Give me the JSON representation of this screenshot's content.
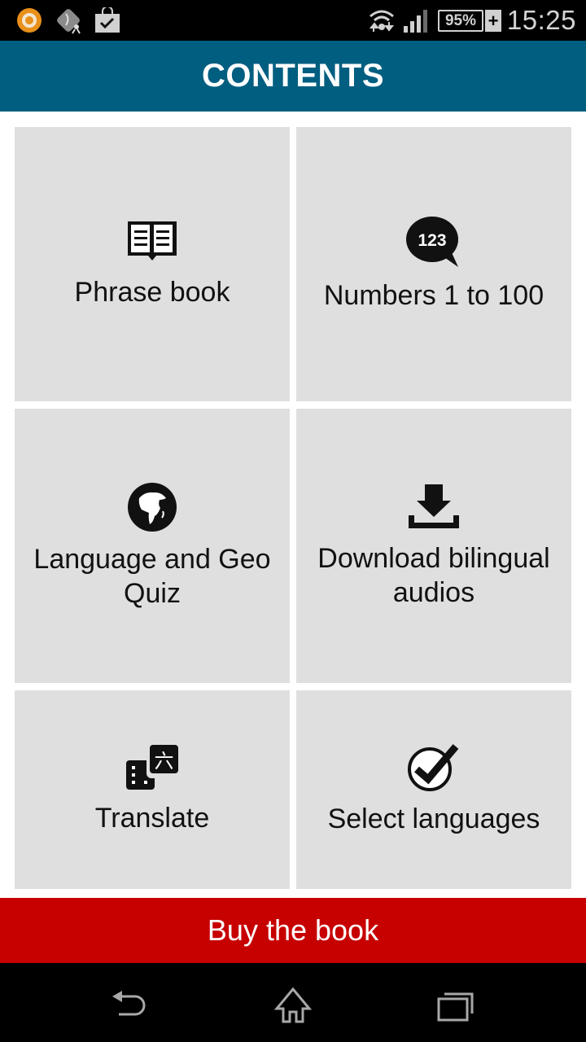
{
  "status_bar": {
    "notification_icons": [
      "avast-icon",
      "app-runner-icon",
      "shopping-bag-check-icon"
    ],
    "system_icons": [
      "wifi-icon",
      "signal-icon",
      "battery-icon",
      "charging-plus-icon"
    ],
    "battery_percent": "95%",
    "time": "15:25"
  },
  "header": {
    "title": "CONTENTS"
  },
  "tiles": [
    {
      "label": "Phrase book",
      "icon": "book-icon"
    },
    {
      "label": "Numbers 1 to 100",
      "icon": "speech-bubble-123-icon",
      "icon_text": "123"
    },
    {
      "label": "Language and Geo Quiz",
      "icon": "globe-icon"
    },
    {
      "label": "Download bilingual audios",
      "icon": "download-icon"
    },
    {
      "label": "Translate",
      "icon": "translate-icon",
      "icon_text": "六"
    },
    {
      "label": "Select languages",
      "icon": "check-circle-icon"
    }
  ],
  "buy_button": {
    "label": "Buy the book"
  },
  "nav_bar": {
    "buttons": [
      "back",
      "home",
      "recent-apps"
    ]
  },
  "colors": {
    "header": "#005e80",
    "buy_button": "#c70000",
    "tile_bg": "#dfdfdf"
  }
}
